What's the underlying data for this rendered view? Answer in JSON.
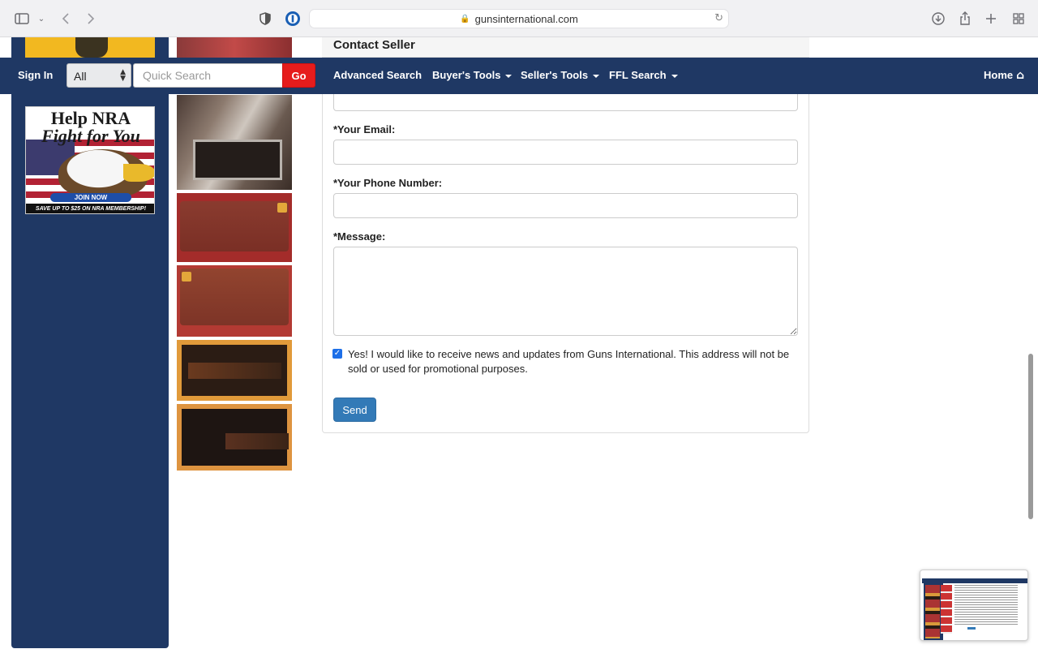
{
  "browser": {
    "url": "gunsinternational.com"
  },
  "nav": {
    "sign_in": "Sign In",
    "category_selected": "All",
    "search_placeholder": "Quick Search",
    "go_label": "Go",
    "links": {
      "advanced_search": "Advanced Search",
      "buyers_tools": "Buyer's Tools",
      "sellers_tools": "Seller's Tools",
      "ffl_search": "FFL Search",
      "home": "Home"
    }
  },
  "ads": {
    "nra_headline_1": "Help NRA",
    "nra_headline_2": "Fight for You",
    "nra_join": "JOIN NOW",
    "nra_save": "SAVE UP TO $25 ON NRA MEMBERSHIP!"
  },
  "contact_form": {
    "title": "Contact Seller",
    "email_label": "*Your Email:",
    "phone_label": "*Your Phone Number:",
    "message_label": "*Message:",
    "newsletter_checked": true,
    "newsletter_text": "Yes! I would like to receive news and updates from Guns International. This address will not be sold or used for promotional purposes.",
    "send_label": "Send"
  },
  "colors": {
    "nav_bg": "#1f3864",
    "go_button": "#e61c1c",
    "send_button": "#337ab7"
  },
  "icons": [
    "sidebar-toggle-icon",
    "chevron-down-icon",
    "back-icon",
    "forward-icon",
    "shield-icon",
    "password-manager-icon",
    "lock-icon",
    "reload-icon",
    "download-icon",
    "share-icon",
    "new-tab-icon",
    "tab-overview-icon",
    "home-icon"
  ]
}
